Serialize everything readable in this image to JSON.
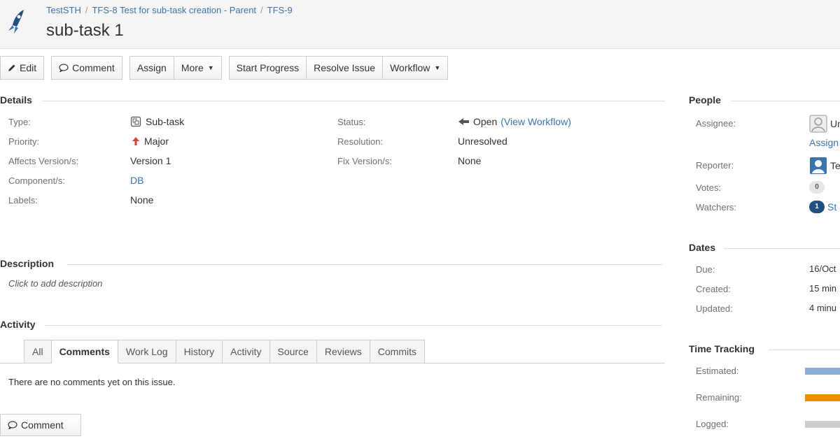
{
  "header": {
    "breadcrumb": [
      "TestSTH",
      "TFS-8 Test for sub-task creation - Parent",
      "TFS-9"
    ],
    "breadcrumb_sep": "/",
    "title": "sub-task 1"
  },
  "toolbar": {
    "edit": "Edit",
    "comment": "Comment",
    "assign": "Assign",
    "more": "More",
    "start_progress": "Start Progress",
    "resolve_issue": "Resolve Issue",
    "workflow": "Workflow"
  },
  "details": {
    "heading": "Details",
    "type_label": "Type:",
    "type_value": "Sub-task",
    "priority_label": "Priority:",
    "priority_value": "Major",
    "affects_label": "Affects Version/s:",
    "affects_value": "Version 1",
    "components_label": "Component/s:",
    "components_value": "DB",
    "labels_label": "Labels:",
    "labels_value": "None",
    "status_label": "Status:",
    "status_value": "Open",
    "status_link": "(View Workflow)",
    "resolution_label": "Resolution:",
    "resolution_value": "Unresolved",
    "fix_label": "Fix Version/s:",
    "fix_value": "None"
  },
  "description": {
    "heading": "Description",
    "placeholder": "Click to add description"
  },
  "activity": {
    "heading": "Activity",
    "tabs": [
      "All",
      "Comments",
      "Work Log",
      "History",
      "Activity",
      "Source",
      "Reviews",
      "Commits"
    ],
    "active_tab": "Comments",
    "empty_text": "There are no comments yet on this issue.",
    "comment_button": "Comment"
  },
  "people": {
    "heading": "People",
    "assignee_label": "Assignee:",
    "assignee_value": "Un",
    "assign_link": "Assign",
    "reporter_label": "Reporter:",
    "reporter_value": "Te",
    "votes_label": "Votes:",
    "votes_count": "0",
    "watchers_label": "Watchers:",
    "watchers_count": "1",
    "watchers_value": "St"
  },
  "dates": {
    "heading": "Dates",
    "due_label": "Due:",
    "due_value": "16/Oct",
    "created_label": "Created:",
    "created_value": "15 min",
    "updated_label": "Updated:",
    "updated_value": "4 minu"
  },
  "time_tracking": {
    "heading": "Time Tracking",
    "estimated_label": "Estimated:",
    "remaining_label": "Remaining:",
    "logged_label": "Logged:",
    "estimated_color": "#89afd7",
    "remaining_color": "#ec8e00",
    "logged_color": "#cccccc"
  },
  "colors": {
    "link": "#3b73af",
    "brand": "#205081"
  }
}
